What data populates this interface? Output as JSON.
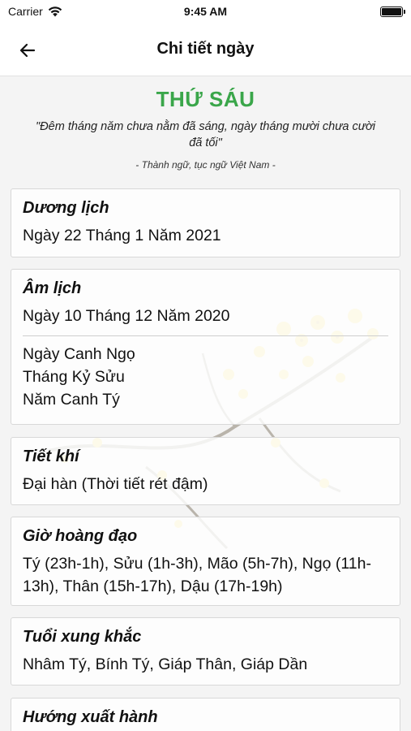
{
  "status_bar": {
    "carrier": "Carrier",
    "time": "9:45 AM"
  },
  "nav": {
    "title": "Chi tiết ngày"
  },
  "header": {
    "weekday": "THỨ SÁU",
    "quote": "\"Đêm tháng năm chưa nằm đã sáng, ngày tháng mười chưa cười đã tối\"",
    "source": "- Thành ngữ, tục ngữ Việt Nam -"
  },
  "cards": {
    "solar": {
      "title": "Dương lịch",
      "value": "Ngày 22 Tháng 1 Năm 2021"
    },
    "lunar": {
      "title": "Âm lịch",
      "value": "Ngày 10 Tháng 12 Năm 2020",
      "day": "Ngày Canh Ngọ",
      "month": "Tháng Kỷ Sửu",
      "year": "Năm Canh Tý"
    },
    "solar_term": {
      "title": "Tiết khí",
      "value": "Đại hàn (Thời tiết rét đậm)"
    },
    "auspicious_hours": {
      "title": "Giờ hoàng đạo",
      "value": "Tý (23h-1h), Sửu (1h-3h), Mão (5h-7h), Ngọ (11h-13h), Thân (15h-17h), Dậu (17h-19h)"
    },
    "conflicting_ages": {
      "title": "Tuổi xung khắc",
      "value": "Nhâm Tý, Bính Tý, Giáp Thân, Giáp Dần"
    },
    "travel_direction": {
      "title": "Hướng xuất hành"
    }
  },
  "colors": {
    "accent": "#3aa64a",
    "flower": "#f3d23a"
  }
}
